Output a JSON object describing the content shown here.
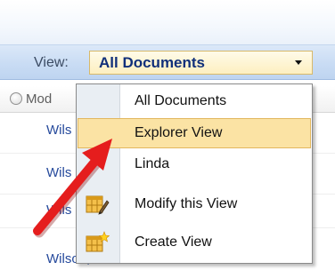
{
  "toolbar": {
    "view_label": "View:",
    "view_value": "All Documents"
  },
  "list": {
    "column_header": "Mod",
    "rows": [
      "Wils",
      "Wils",
      "Wils",
      "Wilson, Linda B."
    ]
  },
  "menu": {
    "items": [
      {
        "label": "All Documents",
        "icon": null
      },
      {
        "label": "Explorer View",
        "icon": null,
        "highlighted": true
      },
      {
        "label": "Linda",
        "icon": null
      },
      {
        "label": "Modify this View",
        "icon": "modify-view-icon"
      },
      {
        "label": "Create View",
        "icon": "create-view-icon"
      }
    ]
  },
  "colors": {
    "toolbar": "#c9dcf4",
    "select_bg": "#fdefc0",
    "highlight": "#fbe3a4",
    "link": "#264a9c",
    "arrow": "#e51d1d"
  }
}
